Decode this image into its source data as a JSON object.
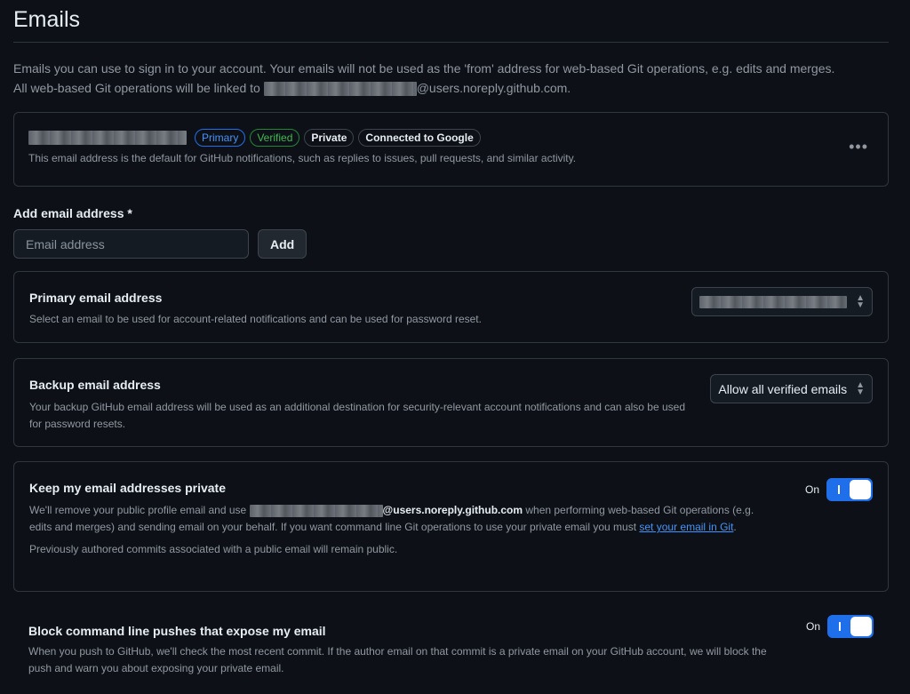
{
  "page": {
    "title": "Emails"
  },
  "intro": {
    "line1": "Emails you can use to sign in to your account. Your emails will not be used as the 'from' address for web-based Git operations, e.g. edits and merges.",
    "line2_prefix": "All web-based Git operations will be linked to ",
    "line2_suffix": "@users.noreply.github.com."
  },
  "email_card": {
    "badges": {
      "primary": "Primary",
      "verified": "Verified",
      "private": "Private",
      "google": "Connected to Google"
    },
    "description": "This email address is the default for GitHub notifications, such as replies to issues, pull requests, and similar activity.",
    "menu_icon": "kebab-horizontal-icon"
  },
  "add_email": {
    "label": "Add email address *",
    "placeholder": "Email address",
    "button": "Add"
  },
  "primary_email": {
    "title": "Primary email address",
    "description": "Select an email to be used for account-related notifications and can be used for password reset."
  },
  "backup_email": {
    "title": "Backup email address",
    "description": "Your backup GitHub email address will be used as an additional destination for security-relevant account notifications and can also be used for password resets.",
    "selected": "Allow all verified emails"
  },
  "keep_private": {
    "title": "Keep my email addresses private",
    "desc_prefix": "We'll remove your public profile email and use ",
    "desc_bold": "@users.noreply.github.com",
    "desc_middle": " when performing web-based Git operations (e.g. edits and merges) and sending email on your behalf. If you want command line Git operations to use your private email you must ",
    "desc_link": "set your email in Git",
    "desc_end": ".",
    "note": "Previously authored commits associated with a public email will remain public.",
    "toggle_label": "On"
  },
  "block_push": {
    "title": "Block command line pushes that expose my email",
    "description": "When you push to GitHub, we'll check the most recent commit. If the author email on that commit is a private email on your GitHub account, we will block the push and warn you about exposing your private email.",
    "toggle_label": "On"
  },
  "colors": {
    "accent": "#1f6feb",
    "success": "#3fb950",
    "link": "#4493f8",
    "background": "#0d1117"
  }
}
